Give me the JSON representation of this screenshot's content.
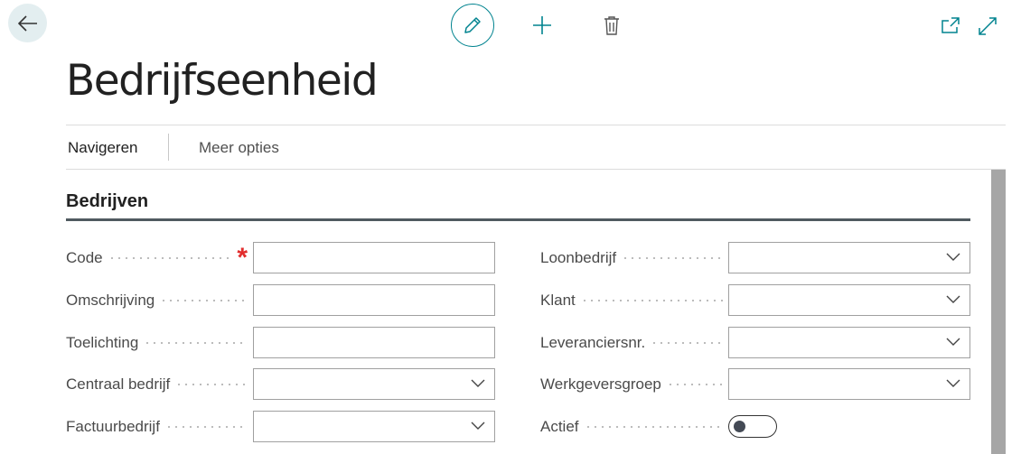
{
  "header": {
    "title": "Bedrijfseenheid",
    "toolbar_icons": [
      "back-arrow-icon",
      "pencil-icon",
      "plus-icon",
      "trash-icon",
      "open-in-new-window-icon",
      "expand-icon"
    ]
  },
  "actions": {
    "navigate": "Navigeren",
    "more": "Meer opties"
  },
  "section": {
    "title": "Bedrijven"
  },
  "left_fields": [
    {
      "label": "Code",
      "value": "",
      "type": "text",
      "required": true
    },
    {
      "label": "Omschrijving",
      "value": "",
      "type": "text"
    },
    {
      "label": "Toelichting",
      "value": "",
      "type": "text"
    },
    {
      "label": "Centraal bedrijf",
      "value": "",
      "type": "select"
    },
    {
      "label": "Factuurbedrijf",
      "value": "",
      "type": "select"
    }
  ],
  "right_fields": [
    {
      "label": "Loonbedrijf",
      "value": "",
      "type": "select"
    },
    {
      "label": "Klant",
      "value": "",
      "type": "select"
    },
    {
      "label": "Leveranciersnr.",
      "value": "",
      "type": "select"
    },
    {
      "label": "Werkgeversgroep",
      "value": "",
      "type": "select"
    },
    {
      "label": "Actief",
      "value": false,
      "type": "toggle"
    }
  ],
  "colors": {
    "accent": "#00838f",
    "required": "#e22d2d",
    "back_button_bg": "#e3eef0"
  }
}
